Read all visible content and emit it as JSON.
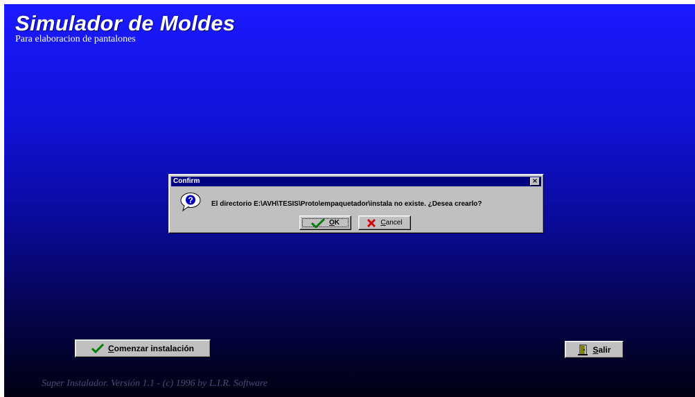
{
  "app": {
    "title": "Simulador de Moldes",
    "subtitle": "Para elaboracion de pantalones",
    "footer": "Super Instalador. Versión 1.1 - (c) 1996 by L.I.R. Software",
    "background_top": "#1a1aff",
    "background_bottom": "#000010"
  },
  "buttons": {
    "comenzar_prefix": "",
    "comenzar_hot": "C",
    "comenzar_rest": "omenzar instalación",
    "salir_hot": "S",
    "salir_rest": "alir",
    "comenzar_icon": "checkmark-icon",
    "salir_icon": "door-exit-icon"
  },
  "dialog": {
    "title": "Confirm",
    "icon": "question-icon",
    "message": "El directorio E:\\AVH\\TESIS\\Proto\\empaquetador\\instala no existe. ¿Desea crearlo?",
    "ok_hot": "O",
    "ok_rest": "K",
    "cancel_hot": "C",
    "cancel_rest": "ancel",
    "titlebar_color": "#000080"
  }
}
